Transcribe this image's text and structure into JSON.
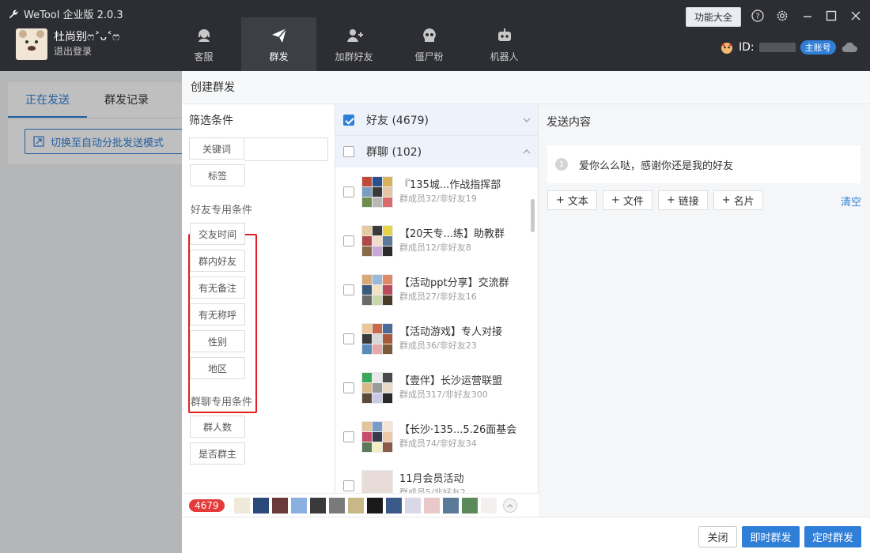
{
  "app": {
    "title": "WeTool 企业版 2.0.3"
  },
  "user": {
    "name": "杜尚别ෆ˃ᴗ˂ෆ",
    "logout": "退出登录"
  },
  "nav": [
    {
      "label": "客服"
    },
    {
      "label": "群发"
    },
    {
      "label": "加群好友"
    },
    {
      "label": "僵尸粉"
    },
    {
      "label": "机器人"
    }
  ],
  "header": {
    "features_label": "功能大全",
    "id_label": "ID:",
    "account_badge": "主账号"
  },
  "background": {
    "tabs": [
      "正在发送",
      "群发记录"
    ],
    "switch_button": "切换至自动分批发送模式"
  },
  "dialog": {
    "title": "创建群发",
    "filter": {
      "title": "筛选条件",
      "keyword_label": "关键词",
      "keyword_value": "",
      "tag_label": "标签",
      "friend_section": "好友专用条件",
      "friend_conditions": [
        "交友时间",
        "群内好友",
        "有无备注",
        "有无称呼",
        "性别",
        "地区"
      ],
      "group_section": "群聊专用条件",
      "group_conditions": [
        "群人数",
        "是否群主"
      ]
    },
    "targets": {
      "friends_label": "好友 (4679)",
      "groups_label": "群聊 (102)",
      "groups": [
        {
          "name": "『135城...作战指挥部",
          "sub": "群成员32/非好友19"
        },
        {
          "name": "【20天专...练】助教群",
          "sub": "群成员12/非好友8"
        },
        {
          "name": "【活动ppt分享】交流群",
          "sub": "群成员27/非好友16"
        },
        {
          "name": "【活动游戏】专人对接",
          "sub": "群成员36/非好友23"
        },
        {
          "name": "【壹伴】长沙运营联盟",
          "sub": "群成员317/非好友300"
        },
        {
          "name": "【长沙·135...5.26面基会",
          "sub": "群成员74/非好友34"
        },
        {
          "name": "11月会员活动",
          "sub": "群成员5/非好友2"
        }
      ],
      "selected_count": "4679"
    },
    "content": {
      "title": "发送内容",
      "message_index": "1",
      "message": "爱你么么哒，感谢你还是我的好友",
      "add_buttons": [
        "文本",
        "文件",
        "链接",
        "名片"
      ],
      "clear": "清空"
    },
    "footer": {
      "close": "关闭",
      "send_now": "即时群发",
      "send_timed": "定时群发"
    }
  },
  "colors": {
    "accent": "#2f7fd9",
    "header_bg": "#2d2e33",
    "highlight_box": "#e02020",
    "count_badge": "#e43a3a"
  }
}
